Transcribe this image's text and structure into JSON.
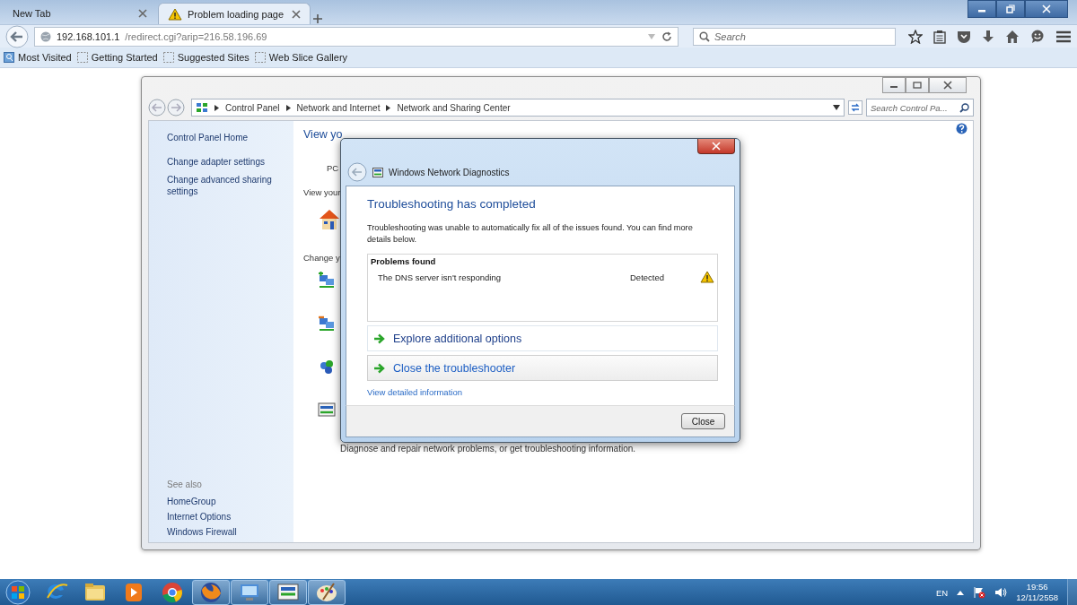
{
  "browser": {
    "tabs": [
      {
        "label": "New Tab",
        "selected": false
      },
      {
        "label": "Problem loading page",
        "selected": true
      }
    ],
    "address": {
      "host": "192.168.101.1",
      "path": "/redirect.cgi?arip=216.58.196.69"
    },
    "search": {
      "placeholder": "Search"
    },
    "bookmarks": [
      {
        "label": "Most Visited",
        "kind": "folder"
      },
      {
        "label": "Getting Started",
        "kind": "page"
      },
      {
        "label": "Suggested Sites",
        "kind": "page"
      },
      {
        "label": "Web Slice Gallery",
        "kind": "page"
      }
    ]
  },
  "control_panel": {
    "breadcrumb": [
      "Control Panel",
      "Network and Internet",
      "Network and Sharing Center"
    ],
    "search": {
      "placeholder": "Search Control Pa..."
    },
    "sidebar": {
      "links": [
        "Control Panel Home",
        "Change adapter settings",
        "Change advanced sharing settings"
      ],
      "see_also_title": "See also",
      "see_also": [
        "HomeGroup",
        "Internet Options",
        "Windows Firewall"
      ]
    },
    "main": {
      "heading": "View yo",
      "pc_label": "PC",
      "view_label": "View your",
      "change_label": "Change y",
      "footer_text": "Diagnose and repair network problems, or get troubleshooting information."
    }
  },
  "dialog": {
    "title": "Windows Network Diagnostics",
    "heading": "Troubleshooting has completed",
    "message": "Troubleshooting was unable to automatically fix all of the issues found. You can find more details below.",
    "problems": {
      "title": "Problems found",
      "rows": [
        {
          "name": "The DNS server isn't responding",
          "status": "Detected"
        }
      ]
    },
    "options": [
      {
        "label": "Explore additional options",
        "hovered": false
      },
      {
        "label": "Close the troubleshooter",
        "hovered": true
      }
    ],
    "details_link": "View detailed information",
    "button": "Close"
  },
  "taskbar": {
    "apps": [
      {
        "kind": "ie",
        "active": false
      },
      {
        "kind": "folder",
        "active": false
      },
      {
        "kind": "media",
        "active": false
      },
      {
        "kind": "chrome",
        "active": false
      },
      {
        "kind": "firefox",
        "active": true
      },
      {
        "kind": "control",
        "active": true
      },
      {
        "kind": "network",
        "active": true
      },
      {
        "kind": "paint",
        "active": true
      }
    ],
    "language": "EN",
    "time": "19:56",
    "date": "12/11/2558"
  }
}
